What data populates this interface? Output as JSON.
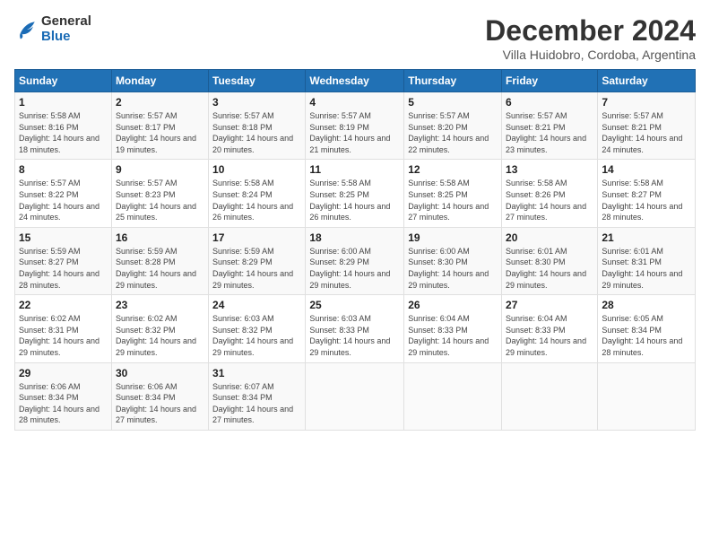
{
  "header": {
    "logo_general": "General",
    "logo_blue": "Blue",
    "month_title": "December 2024",
    "subtitle": "Villa Huidobro, Cordoba, Argentina"
  },
  "weekdays": [
    "Sunday",
    "Monday",
    "Tuesday",
    "Wednesday",
    "Thursday",
    "Friday",
    "Saturday"
  ],
  "weeks": [
    [
      {
        "day": "1",
        "sunrise": "Sunrise: 5:58 AM",
        "sunset": "Sunset: 8:16 PM",
        "daylight": "Daylight: 14 hours and 18 minutes."
      },
      {
        "day": "2",
        "sunrise": "Sunrise: 5:57 AM",
        "sunset": "Sunset: 8:17 PM",
        "daylight": "Daylight: 14 hours and 19 minutes."
      },
      {
        "day": "3",
        "sunrise": "Sunrise: 5:57 AM",
        "sunset": "Sunset: 8:18 PM",
        "daylight": "Daylight: 14 hours and 20 minutes."
      },
      {
        "day": "4",
        "sunrise": "Sunrise: 5:57 AM",
        "sunset": "Sunset: 8:19 PM",
        "daylight": "Daylight: 14 hours and 21 minutes."
      },
      {
        "day": "5",
        "sunrise": "Sunrise: 5:57 AM",
        "sunset": "Sunset: 8:20 PM",
        "daylight": "Daylight: 14 hours and 22 minutes."
      },
      {
        "day": "6",
        "sunrise": "Sunrise: 5:57 AM",
        "sunset": "Sunset: 8:21 PM",
        "daylight": "Daylight: 14 hours and 23 minutes."
      },
      {
        "day": "7",
        "sunrise": "Sunrise: 5:57 AM",
        "sunset": "Sunset: 8:21 PM",
        "daylight": "Daylight: 14 hours and 24 minutes."
      }
    ],
    [
      {
        "day": "8",
        "sunrise": "Sunrise: 5:57 AM",
        "sunset": "Sunset: 8:22 PM",
        "daylight": "Daylight: 14 hours and 24 minutes."
      },
      {
        "day": "9",
        "sunrise": "Sunrise: 5:57 AM",
        "sunset": "Sunset: 8:23 PM",
        "daylight": "Daylight: 14 hours and 25 minutes."
      },
      {
        "day": "10",
        "sunrise": "Sunrise: 5:58 AM",
        "sunset": "Sunset: 8:24 PM",
        "daylight": "Daylight: 14 hours and 26 minutes."
      },
      {
        "day": "11",
        "sunrise": "Sunrise: 5:58 AM",
        "sunset": "Sunset: 8:25 PM",
        "daylight": "Daylight: 14 hours and 26 minutes."
      },
      {
        "day": "12",
        "sunrise": "Sunrise: 5:58 AM",
        "sunset": "Sunset: 8:25 PM",
        "daylight": "Daylight: 14 hours and 27 minutes."
      },
      {
        "day": "13",
        "sunrise": "Sunrise: 5:58 AM",
        "sunset": "Sunset: 8:26 PM",
        "daylight": "Daylight: 14 hours and 27 minutes."
      },
      {
        "day": "14",
        "sunrise": "Sunrise: 5:58 AM",
        "sunset": "Sunset: 8:27 PM",
        "daylight": "Daylight: 14 hours and 28 minutes."
      }
    ],
    [
      {
        "day": "15",
        "sunrise": "Sunrise: 5:59 AM",
        "sunset": "Sunset: 8:27 PM",
        "daylight": "Daylight: 14 hours and 28 minutes."
      },
      {
        "day": "16",
        "sunrise": "Sunrise: 5:59 AM",
        "sunset": "Sunset: 8:28 PM",
        "daylight": "Daylight: 14 hours and 29 minutes."
      },
      {
        "day": "17",
        "sunrise": "Sunrise: 5:59 AM",
        "sunset": "Sunset: 8:29 PM",
        "daylight": "Daylight: 14 hours and 29 minutes."
      },
      {
        "day": "18",
        "sunrise": "Sunrise: 6:00 AM",
        "sunset": "Sunset: 8:29 PM",
        "daylight": "Daylight: 14 hours and 29 minutes."
      },
      {
        "day": "19",
        "sunrise": "Sunrise: 6:00 AM",
        "sunset": "Sunset: 8:30 PM",
        "daylight": "Daylight: 14 hours and 29 minutes."
      },
      {
        "day": "20",
        "sunrise": "Sunrise: 6:01 AM",
        "sunset": "Sunset: 8:30 PM",
        "daylight": "Daylight: 14 hours and 29 minutes."
      },
      {
        "day": "21",
        "sunrise": "Sunrise: 6:01 AM",
        "sunset": "Sunset: 8:31 PM",
        "daylight": "Daylight: 14 hours and 29 minutes."
      }
    ],
    [
      {
        "day": "22",
        "sunrise": "Sunrise: 6:02 AM",
        "sunset": "Sunset: 8:31 PM",
        "daylight": "Daylight: 14 hours and 29 minutes."
      },
      {
        "day": "23",
        "sunrise": "Sunrise: 6:02 AM",
        "sunset": "Sunset: 8:32 PM",
        "daylight": "Daylight: 14 hours and 29 minutes."
      },
      {
        "day": "24",
        "sunrise": "Sunrise: 6:03 AM",
        "sunset": "Sunset: 8:32 PM",
        "daylight": "Daylight: 14 hours and 29 minutes."
      },
      {
        "day": "25",
        "sunrise": "Sunrise: 6:03 AM",
        "sunset": "Sunset: 8:33 PM",
        "daylight": "Daylight: 14 hours and 29 minutes."
      },
      {
        "day": "26",
        "sunrise": "Sunrise: 6:04 AM",
        "sunset": "Sunset: 8:33 PM",
        "daylight": "Daylight: 14 hours and 29 minutes."
      },
      {
        "day": "27",
        "sunrise": "Sunrise: 6:04 AM",
        "sunset": "Sunset: 8:33 PM",
        "daylight": "Daylight: 14 hours and 29 minutes."
      },
      {
        "day": "28",
        "sunrise": "Sunrise: 6:05 AM",
        "sunset": "Sunset: 8:34 PM",
        "daylight": "Daylight: 14 hours and 28 minutes."
      }
    ],
    [
      {
        "day": "29",
        "sunrise": "Sunrise: 6:06 AM",
        "sunset": "Sunset: 8:34 PM",
        "daylight": "Daylight: 14 hours and 28 minutes."
      },
      {
        "day": "30",
        "sunrise": "Sunrise: 6:06 AM",
        "sunset": "Sunset: 8:34 PM",
        "daylight": "Daylight: 14 hours and 27 minutes."
      },
      {
        "day": "31",
        "sunrise": "Sunrise: 6:07 AM",
        "sunset": "Sunset: 8:34 PM",
        "daylight": "Daylight: 14 hours and 27 minutes."
      },
      null,
      null,
      null,
      null
    ]
  ]
}
